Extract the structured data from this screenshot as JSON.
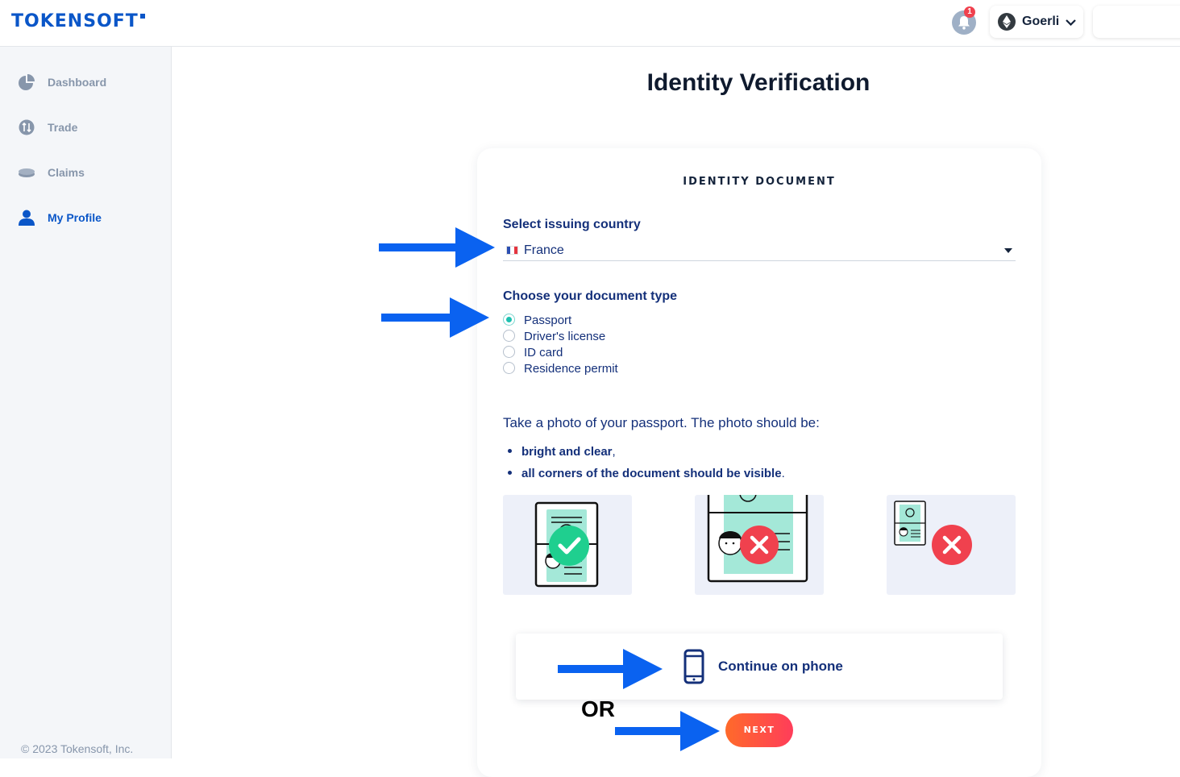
{
  "header": {
    "logo_text": "TOKENSOFT",
    "notification_count": "1",
    "network_label": "Goerli",
    "network_icon": "ethereum-icon",
    "chevron": "⌄"
  },
  "sidebar": {
    "items": [
      {
        "label": "Dashboard",
        "icon": "pie-chart-icon",
        "active": false
      },
      {
        "label": "Trade",
        "icon": "trade-icon",
        "active": false
      },
      {
        "label": "Claims",
        "icon": "coins-icon",
        "active": false
      },
      {
        "label": "My Profile",
        "icon": "user-icon",
        "active": true
      }
    ],
    "footer": "© 2023 Tokensoft, Inc."
  },
  "main": {
    "title": "Identity Verification",
    "card": {
      "section_title": "IDENTITY DOCUMENT",
      "country_label": "Select issuing country",
      "country_value": "France",
      "doc_type_label": "Choose your document type",
      "doc_types": [
        {
          "label": "Passport",
          "checked": true
        },
        {
          "label": "Driver's license",
          "checked": false
        },
        {
          "label": "ID card",
          "checked": false
        },
        {
          "label": "Residence permit",
          "checked": false
        }
      ],
      "instructions": "Take a photo of your passport. The photo should be:",
      "bullets": [
        {
          "bold": "bright and clear",
          "rest": ","
        },
        {
          "bold": "all corners of the document should be visible",
          "rest": "."
        }
      ],
      "continue_phone_label": "Continue on phone",
      "next_label": "NEXT"
    }
  },
  "annotations": {
    "or_text": "OR",
    "arrow_color": "#0a62f0"
  },
  "colors": {
    "brand_blue": "#0a56c8",
    "navy_text": "#14307a",
    "accent_teal": "#1ec0b0",
    "error_red": "#f0414e",
    "next_gradient_start": "#ff6a2a",
    "next_gradient_end": "#ff3d5a"
  }
}
